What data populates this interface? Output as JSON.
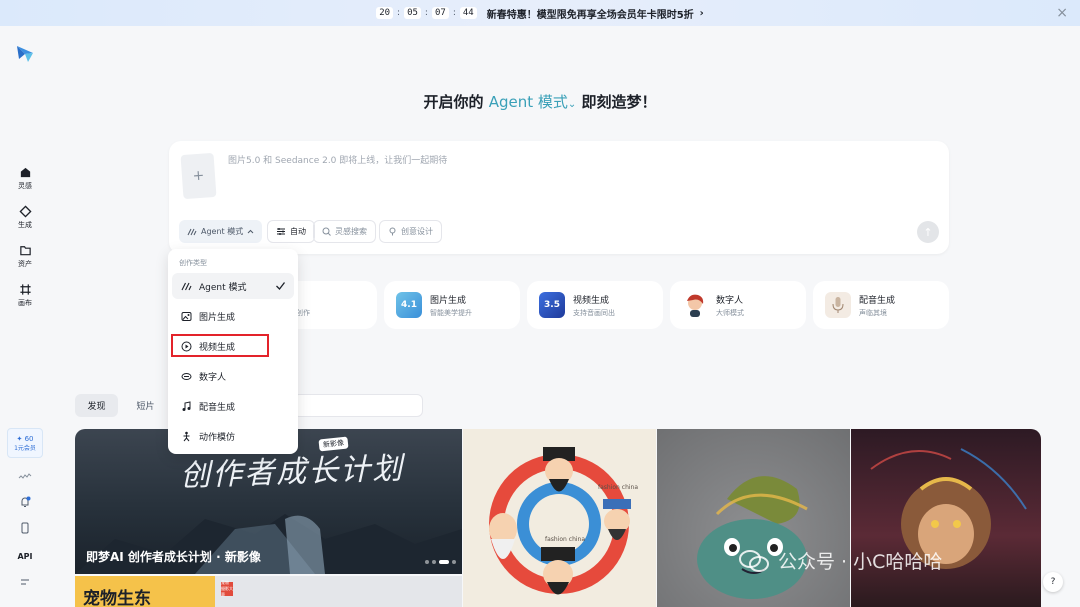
{
  "banner": {
    "time": [
      "20",
      "05",
      "07",
      "44"
    ],
    "colon": ":",
    "text": "新春特惠！模型限免再享全场会员年卡限时5折",
    "arrow": "›",
    "close": "×"
  },
  "sidebar": {
    "items": [
      {
        "label": "灵感",
        "icon": "home-icon"
      },
      {
        "label": "生成",
        "icon": "diamond-icon"
      },
      {
        "label": "资产",
        "icon": "folder-icon"
      },
      {
        "label": "画布",
        "icon": "canvas-icon"
      }
    ],
    "credit": {
      "value": "✦ 60",
      "label": "1元会员"
    },
    "api": "API"
  },
  "headline": {
    "prefix": "开启你的",
    "accent": "Agent 模式",
    "suffix": "即刻造梦！"
  },
  "prompt": {
    "upload_plus": "+",
    "placeholder": "图片5.0 和 Seedance 2.0 即将上线，让我们一起期待",
    "agent_label": "Agent 模式",
    "auto_label": "自动",
    "search_label": "灵感搜索",
    "design_label": "创意设计",
    "send": "↑"
  },
  "features": [
    {
      "title": "图片生成",
      "sub": "智能美学提升",
      "badge": "4.1",
      "color": "#3a8fd9"
    },
    {
      "title": "视频生成",
      "sub": "支持音画同出",
      "badge": "3.5",
      "color": "#2d4fb8"
    },
    {
      "title": "数字人",
      "sub": "大师模式",
      "badge": "",
      "color": "#d96a4a"
    },
    {
      "title": "配音生成",
      "sub": "声临其境",
      "badge": "",
      "color": "#e9d6c6"
    }
  ],
  "feature_partial_sub": "创作",
  "tabs": {
    "discover": "发现",
    "short": "短片"
  },
  "dropdown": {
    "header": "创作类型",
    "items": [
      {
        "label": "Agent 模式",
        "icon": "agent-icon",
        "selected": true
      },
      {
        "label": "图片生成",
        "icon": "image-icon",
        "selected": false
      },
      {
        "label": "视频生成",
        "icon": "video-icon",
        "selected": false
      },
      {
        "label": "数字人",
        "icon": "avatar-icon",
        "selected": false
      },
      {
        "label": "配音生成",
        "icon": "music-icon",
        "selected": false
      },
      {
        "label": "动作模仿",
        "icon": "motion-icon",
        "selected": false
      }
    ]
  },
  "gallery": {
    "hero_art": "创作者成长计划",
    "hero_badge": "新影像",
    "hero_title": "即梦AI 创作者成长计划 · 新影像",
    "second_text": "宠物生东",
    "second_badge": "宠物 摄影大赛",
    "caption1": "fashion china",
    "caption2": "fashion china"
  },
  "watermark": "公众号 · 小C哈哈哈",
  "help": "?"
}
